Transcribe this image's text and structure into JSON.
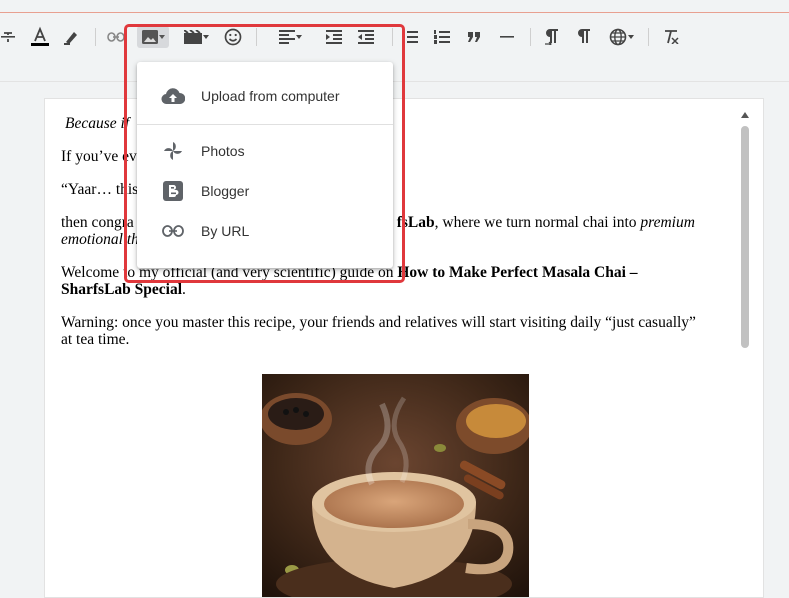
{
  "toolbar": {
    "buttons": [
      {
        "name": "strikethrough",
        "interactable": true
      },
      {
        "name": "text-color",
        "interactable": true
      },
      {
        "name": "highlight-color",
        "interactable": true
      },
      {
        "name": "link",
        "interactable": true
      },
      {
        "name": "insert-image",
        "interactable": true,
        "active": true
      },
      {
        "name": "insert-video",
        "interactable": true
      },
      {
        "name": "insert-emoji",
        "interactable": true
      },
      {
        "name": "alignment",
        "interactable": true
      },
      {
        "name": "indent",
        "interactable": true
      },
      {
        "name": "outdent",
        "interactable": true
      },
      {
        "name": "bulleted-list",
        "interactable": true
      },
      {
        "name": "numbered-list",
        "interactable": true
      },
      {
        "name": "quote",
        "interactable": true
      },
      {
        "name": "horizontal-rule",
        "interactable": true
      },
      {
        "name": "ltr",
        "interactable": true
      },
      {
        "name": "rtl",
        "interactable": true
      },
      {
        "name": "language",
        "interactable": true
      },
      {
        "name": "clear-formatting",
        "interactable": true
      }
    ]
  },
  "image_menu": {
    "items": [
      {
        "label": "Upload from computer",
        "icon": "cloud-upload-icon"
      },
      {
        "label": "Photos",
        "icon": "google-photos-icon"
      },
      {
        "label": "Blogger",
        "icon": "blogger-icon"
      },
      {
        "label": "By URL",
        "icon": "link-icon"
      }
    ]
  },
  "editor": {
    "line1_italic": "Because if",
    "line2": "If you’ve ev",
    "line3": "“Yaar… this",
    "para_congrats_start": "then congra",
    "para_congrats_bold": "fsLab",
    "para_congrats_end": ", where we turn normal chai into ",
    "para_congrats_italic1": "premium",
    "para_congrats_italic2": "emotional th",
    "para_welcome": "Welcome to my official (and very scientific) guide on ",
    "para_welcome_bold": "How to Make Perfect Masala Chai – SharfsLab Special",
    "para_welcome_end": ".",
    "para_warning": "Warning: once you master this recipe, your friends and relatives will start visiting daily “just casually” at tea time."
  },
  "colors": {
    "highlight_border": "#e0383c",
    "accent_line": "#e8a090",
    "toolbar_bg": "#f1f3f4"
  }
}
